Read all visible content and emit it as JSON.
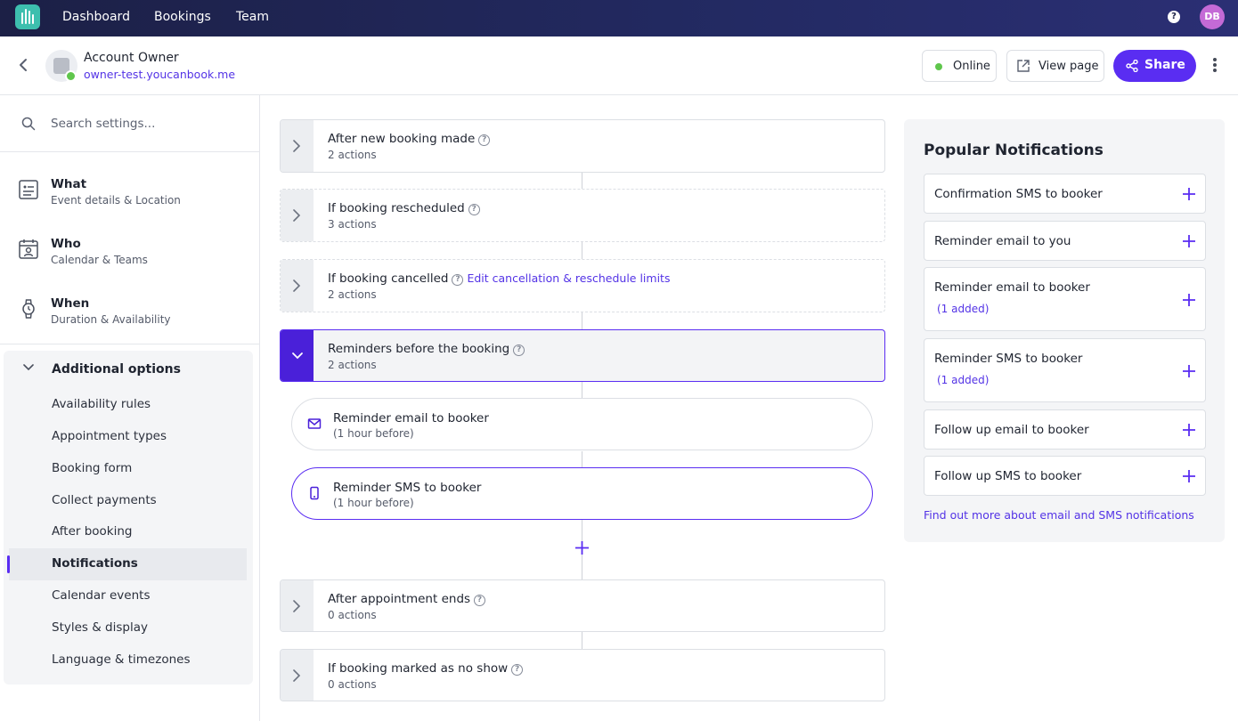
{
  "nav": {
    "links": [
      "Dashboard",
      "Bookings",
      "Team"
    ],
    "help_icon": "help-circle-icon",
    "avatar_initials": "DB"
  },
  "header": {
    "account_name": "Account Owner",
    "account_url": "owner-test.youcanbook.me",
    "online_label": "Online",
    "view_page_label": "View page",
    "share_label": "Share"
  },
  "sidebar": {
    "search_placeholder": "Search settings...",
    "sections": [
      {
        "title": "What",
        "subtitle": "Event details & Location",
        "icon": "form-icon"
      },
      {
        "title": "Who",
        "subtitle": "Calendar & Teams",
        "icon": "calendar-person-icon"
      },
      {
        "title": "When",
        "subtitle": "Duration & Availability",
        "icon": "watch-icon"
      }
    ],
    "additional": {
      "title": "Additional options",
      "items": [
        "Availability rules",
        "Appointment types",
        "Booking form",
        "Collect payments",
        "After booking",
        "Notifications",
        "Calendar events",
        "Styles & display",
        "Language & timezones"
      ],
      "active_item": "Notifications"
    }
  },
  "triggers": [
    {
      "title": "After new booking made",
      "count": "2 actions"
    },
    {
      "title": "If booking rescheduled",
      "count": "3 actions"
    },
    {
      "title": "If booking cancelled",
      "count": "2 actions",
      "link": "Edit cancellation & reschedule limits"
    },
    {
      "title": "Reminders before the booking",
      "count": "2 actions"
    },
    {
      "title": "After appointment ends",
      "count": "0 actions"
    },
    {
      "title": "If booking marked as no show",
      "count": "0 actions"
    }
  ],
  "reminder_actions": [
    {
      "title": "Reminder email to booker",
      "subtitle": "(1 hour before)",
      "icon": "mail-icon"
    },
    {
      "title": "Reminder SMS to booker",
      "subtitle": "(1 hour before)",
      "icon": "phone-icon"
    }
  ],
  "popular": {
    "title": "Popular Notifications",
    "items": [
      {
        "label": "Confirmation SMS to booker",
        "added": ""
      },
      {
        "label": "Reminder email to you",
        "added": ""
      },
      {
        "label": "Reminder email to booker",
        "added": "(1 added)"
      },
      {
        "label": "Reminder SMS to booker",
        "added": "(1 added)"
      },
      {
        "label": "Follow up email to booker",
        "added": ""
      },
      {
        "label": "Follow up SMS to booker",
        "added": ""
      }
    ],
    "link": "Find out more about email and SMS notifications"
  },
  "colors": {
    "accent": "#5a2df2",
    "online_green": "#5fc64c",
    "logo_teal": "#3dbfae",
    "avatar_pink": "#c46ad6"
  }
}
